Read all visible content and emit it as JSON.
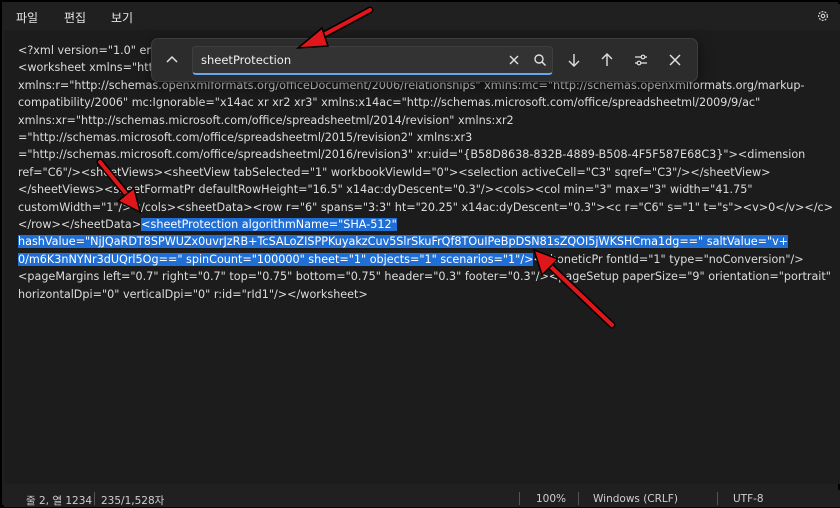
{
  "menu": {
    "file": "파일",
    "edit": "편집",
    "view": "보기"
  },
  "find": {
    "query": "sheetProtection"
  },
  "editor": {
    "lines": [
      "<?xml version=\"1.0\" enc",
      "<worksheet xmlns=\"htt",
      "xmlns:r=\"http://schemas.openxmlformats.org/officeDocument/2006/relationships\" xmlns:mc=\"http://schemas.openxmlformats.org/markup-",
      "compatibility/2006\" mc:Ignorable=\"x14ac xr xr2 xr3\" xmlns:x14ac=\"http://schemas.microsoft.com/office/spreadsheetml/2009/9/ac\"",
      "xmlns:xr=\"http://schemas.microsoft.com/office/spreadsheetml/2014/revision\" xmlns:xr2",
      "=\"http://schemas.microsoft.com/office/spreadsheetml/2015/revision2\" xmlns:xr3",
      "=\"http://schemas.microsoft.com/office/spreadsheetml/2016/revision3\" xr:uid=\"{B58D8638-832B-4889-B508-4F5F587E68C3}\"><dimension",
      "ref=\"C6\"/><sheetViews><sheetView tabSelected=\"1\" workbookViewId=\"0\"><selection activeCell=\"C3\" sqref=\"C3\"/></sheetView>",
      "</sheetViews><sheetFormatPr defaultRowHeight=\"16.5\" x14ac:dyDescent=\"0.3\"/><cols><col min=\"3\" max=\"3\" width=\"41.75\"",
      "customWidth=\"1\"/></cols><sheetData><row r=\"6\" spans=\"3:3\" ht=\"20.25\" x14ac:dyDescent=\"0.3\"><c r=\"C6\" s=\"1\" t=\"s\"><v>0</v></c>"
    ],
    "line10_pre": "</row></sheetData>",
    "line10_sel": "<sheetProtection algorithmName=\"SHA-512\"",
    "line11_sel": "hashValue=\"NjJQaRDT8SPWUZx0uvrJzRB+TcSALoZISPPKuyakzCuv5SlrSkuFrQf8TOuIPeBpDSN81sZQOI5jWKSHCma1dg==\" saltValue=\"v+",
    "line12_sel": "0/m6K3nNYNr3dUQrl5Og==\" spinCount=\"100000\" sheet=\"1\" objects=\"1\" scenarios=\"1\"/>",
    "line12_post": "<phoneticPr fontId=\"1\" type=\"noConversion\"/>",
    "line13": "<pageMargins left=\"0.7\" right=\"0.7\" top=\"0.75\" bottom=\"0.75\" header=\"0.3\" footer=\"0.3\"/><pageSetup paperSize=\"9\" orientation=\"portrait\"",
    "line14": "horizontalDpi=\"0\" verticalDpi=\"0\" r:id=\"rId1\"/></worksheet>"
  },
  "status": {
    "position": "줄 2, 열 1234",
    "chars": "235/1,528자",
    "zoom": "100%",
    "line_ending": "Windows (CRLF)",
    "encoding": "UTF-8"
  },
  "colors": {
    "selection": "#1f6fd6",
    "annotation_arrow": "#e0161b"
  },
  "icons": [
    "gear-icon",
    "chevron-up-icon",
    "clear-icon",
    "search-icon",
    "arrow-down-icon",
    "arrow-up-icon",
    "find-options-icon",
    "close-icon"
  ]
}
